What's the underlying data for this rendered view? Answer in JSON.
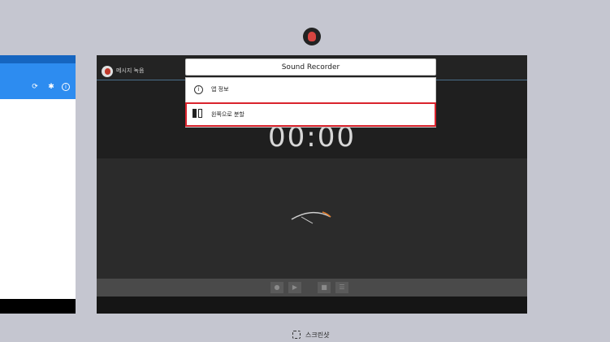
{
  "recorder_card": {
    "app_title": "메시지 녹음",
    "timer": "00:00",
    "controls": [
      "record",
      "play",
      "stop",
      "list"
    ]
  },
  "menu": {
    "header": "Sound Recorder",
    "items": [
      {
        "label": "앱 정보",
        "icon": "info-icon"
      },
      {
        "label": "왼쪽으로 분할",
        "icon": "split-left-icon"
      }
    ],
    "highlight_color": "#d9232d"
  },
  "left_card": {
    "icons": [
      "sync-icon",
      "gear-icon",
      "info-icon"
    ],
    "accent": "#2d8cf0"
  },
  "screenshot": {
    "label": "스크린샷"
  }
}
